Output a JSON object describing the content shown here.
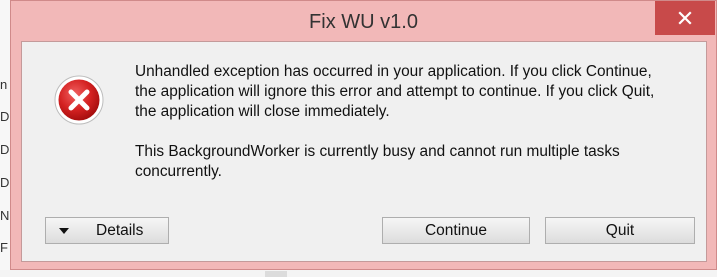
{
  "window": {
    "title": "Fix WU v1.0",
    "close_label": "close"
  },
  "background_letters": [
    "n",
    "D",
    "D",
    "D",
    "N",
    "F"
  ],
  "message": {
    "paragraph1": "Unhandled exception has occurred in your application. If you click Continue, the application will ignore this error and attempt to continue. If you click Quit, the application will close immediately.",
    "paragraph2": "This BackgroundWorker is currently busy and cannot run multiple tasks concurrently."
  },
  "buttons": {
    "details": "Details",
    "continue": "Continue",
    "quit": "Quit"
  },
  "icons": {
    "error": "error-x-icon",
    "close": "close-icon",
    "details_caret": "caret-down-icon"
  },
  "colors": {
    "title_bar": "#f2b8b8",
    "close_button": "#c84a4a",
    "error_red": "#d42121"
  }
}
